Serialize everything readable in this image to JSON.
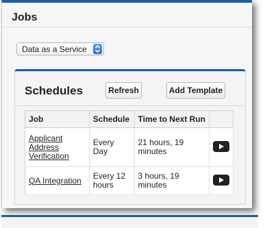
{
  "header": {
    "title": "Jobs"
  },
  "service_select": {
    "value": "Data as a Service"
  },
  "schedules": {
    "title": "Schedules",
    "refresh_label": "Refresh",
    "add_template_label": "Add Template",
    "columns": [
      "Job",
      "Schedule",
      "Time to Next Run",
      ""
    ],
    "rows": [
      {
        "job": "Applicant Address Verification",
        "schedule": "Every Day",
        "next_run": "21 hours, 19 minutes",
        "action_icon": "play-icon"
      },
      {
        "job": "QA Integration",
        "schedule": "Every 12 hours",
        "next_run": "3 hours, 19 minutes",
        "action_icon": "play-icon"
      }
    ]
  },
  "colors": {
    "accent": "#1f5ba8",
    "select_arrow": "#2f7ff0"
  }
}
